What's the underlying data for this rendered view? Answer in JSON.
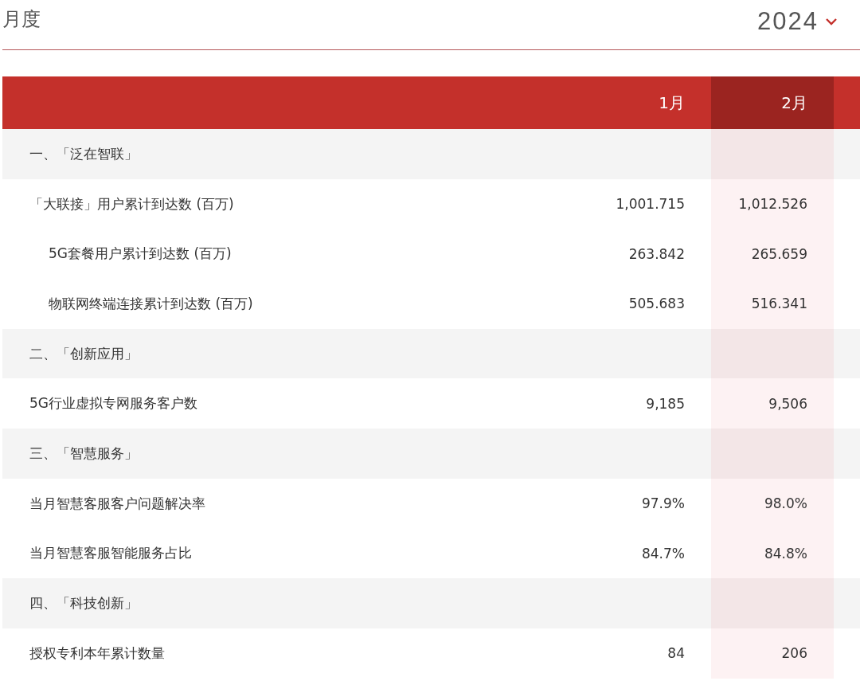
{
  "header": {
    "title": "月度",
    "year": "2024"
  },
  "table": {
    "columns": [
      {
        "label": "1月",
        "selected": false
      },
      {
        "label": "2月",
        "selected": true
      }
    ],
    "rows": [
      {
        "kind": "section",
        "label": "一、「泛在智联」"
      },
      {
        "kind": "data",
        "label": "「大联接」用户累计到达数 (百万)",
        "values": [
          "1,001.715",
          "1,012.526"
        ],
        "children": [
          {
            "kind": "data",
            "label": "5G套餐用户累计到达数 (百万)",
            "values": [
              "263.842",
              "265.659"
            ]
          },
          {
            "kind": "data",
            "label": "物联网终端连接累计到达数 (百万)",
            "values": [
              "505.683",
              "516.341"
            ]
          }
        ]
      },
      {
        "kind": "section",
        "label": "二、「创新应用」"
      },
      {
        "kind": "data",
        "label": "5G行业虚拟专网服务客户数",
        "values": [
          "9,185",
          "9,506"
        ]
      },
      {
        "kind": "section",
        "label": "三、「智慧服务」"
      },
      {
        "kind": "data",
        "label": "当月智慧客服客户问题解决率",
        "values": [
          "97.9%",
          "98.0%"
        ]
      },
      {
        "kind": "data",
        "label": "当月智慧客服智能服务占比",
        "values": [
          "84.7%",
          "84.8%"
        ]
      },
      {
        "kind": "section",
        "label": "四、「科技创新」"
      },
      {
        "kind": "data",
        "label": "授权专利本年累计数量",
        "values": [
          "84",
          "206"
        ]
      }
    ]
  }
}
